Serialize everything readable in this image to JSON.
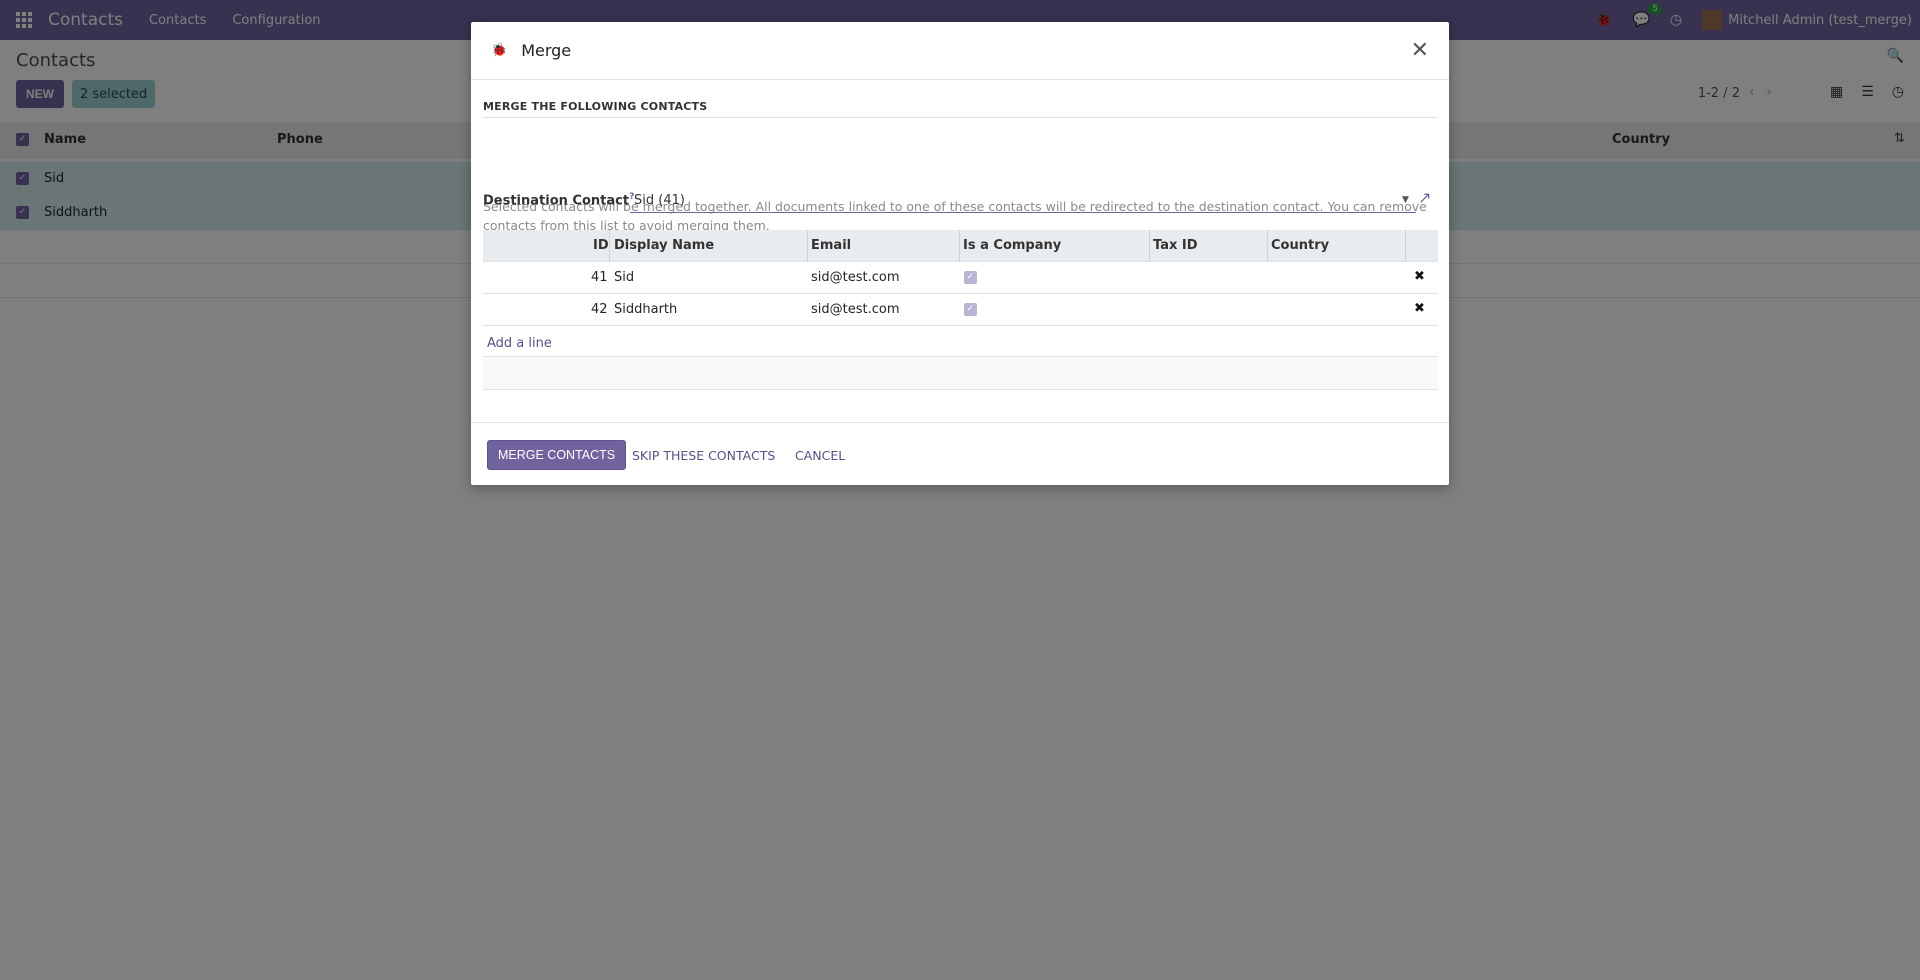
{
  "navbar": {
    "app_name": "Contacts",
    "menu": [
      "Contacts",
      "Configuration"
    ],
    "messages_count": "5",
    "user_name": "Mitchell Admin (test_merge)"
  },
  "control_panel": {
    "title": "Contacts",
    "new_label": "NEW",
    "selected_label": "2 selected",
    "pager": "1-2 / 2"
  },
  "list": {
    "columns": [
      "Name",
      "Phone",
      "Country"
    ],
    "rows": [
      {
        "name": "Sid"
      },
      {
        "name": "Siddharth"
      }
    ]
  },
  "modal": {
    "title": "Merge",
    "section_title": "MERGE THE FOLLOWING CONTACTS",
    "description": "Selected contacts will be merged together. All documents linked to one of these contacts will be redirected to the destination contact. You can remove contacts from this list to avoid merging them.",
    "destination_label": "Destination Contact",
    "destination_help": "?",
    "destination_value": "Sid (41)",
    "table": {
      "columns": [
        "ID",
        "Display Name",
        "Email",
        "Is a Company",
        "Tax ID",
        "Country"
      ],
      "rows": [
        {
          "id": "41",
          "display_name": "Sid",
          "email": "sid@test.com",
          "is_company": true,
          "tax_id": "",
          "country": ""
        },
        {
          "id": "42",
          "display_name": "Siddharth",
          "email": "sid@test.com",
          "is_company": true,
          "tax_id": "",
          "country": ""
        }
      ]
    },
    "add_line_label": "Add a line",
    "buttons": {
      "merge": "MERGE CONTACTS",
      "skip": "SKIP THESE CONTACTS",
      "cancel": "CANCEL"
    }
  },
  "colors": {
    "brand": "#71639e",
    "selected_row": "#d5ebeb",
    "overlay": "rgba(0,0,0,0.5)"
  }
}
